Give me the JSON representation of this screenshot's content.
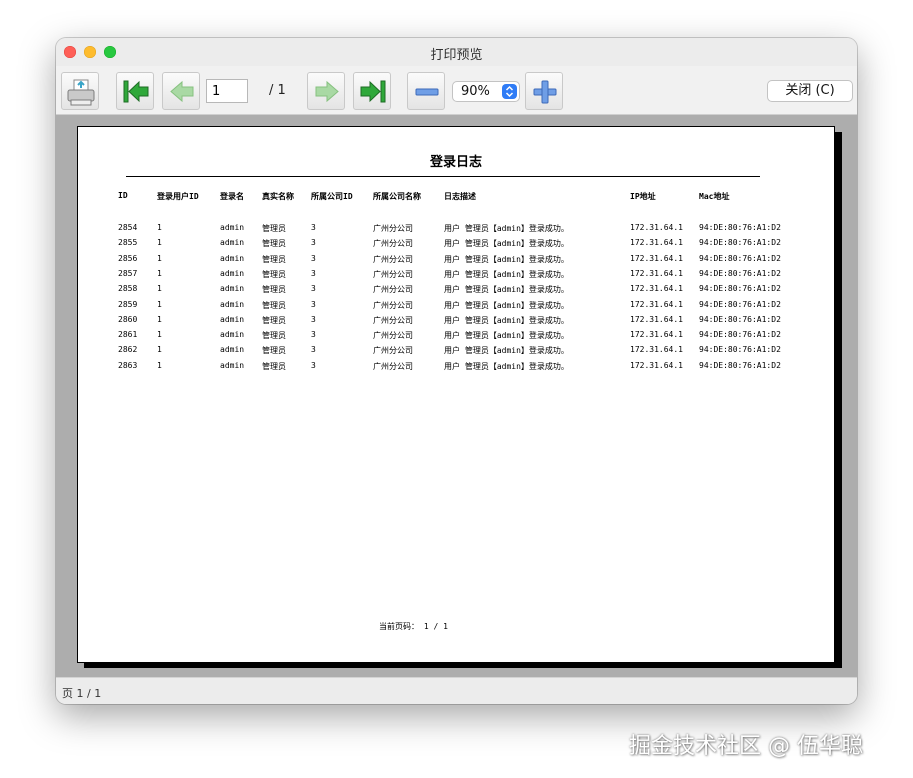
{
  "window": {
    "title": "打印预览"
  },
  "toolbar": {
    "page_value": "1",
    "page_total": "/ 1",
    "zoom_value": "90%",
    "close_label": "关闭 (C)",
    "icons": {
      "print": "printer-icon",
      "first": "first-page-icon",
      "prev": "previous-page-icon",
      "next": "next-page-icon",
      "last": "last-page-icon",
      "zoom_out": "zoom-out-icon",
      "zoom_in": "zoom-in-icon"
    }
  },
  "report": {
    "title": "登录日志",
    "columns": [
      "ID",
      "登录用户ID",
      "登录名",
      "真实名称",
      "所属公司ID",
      "所属公司名称",
      "日志描述",
      "IP地址",
      "Mac地址"
    ],
    "rows": [
      [
        "2854",
        "1",
        "admin",
        "管理员",
        "3",
        "广州分公司",
        "用户 管理员【admin】登录成功。",
        "172.31.64.1",
        "94:DE:80:76:A1:D2"
      ],
      [
        "2855",
        "1",
        "admin",
        "管理员",
        "3",
        "广州分公司",
        "用户 管理员【admin】登录成功。",
        "172.31.64.1",
        "94:DE:80:76:A1:D2"
      ],
      [
        "2856",
        "1",
        "admin",
        "管理员",
        "3",
        "广州分公司",
        "用户 管理员【admin】登录成功。",
        "172.31.64.1",
        "94:DE:80:76:A1:D2"
      ],
      [
        "2857",
        "1",
        "admin",
        "管理员",
        "3",
        "广州分公司",
        "用户 管理员【admin】登录成功。",
        "172.31.64.1",
        "94:DE:80:76:A1:D2"
      ],
      [
        "2858",
        "1",
        "admin",
        "管理员",
        "3",
        "广州分公司",
        "用户 管理员【admin】登录成功。",
        "172.31.64.1",
        "94:DE:80:76:A1:D2"
      ],
      [
        "2859",
        "1",
        "admin",
        "管理员",
        "3",
        "广州分公司",
        "用户 管理员【admin】登录成功。",
        "172.31.64.1",
        "94:DE:80:76:A1:D2"
      ],
      [
        "2860",
        "1",
        "admin",
        "管理员",
        "3",
        "广州分公司",
        "用户 管理员【admin】登录成功。",
        "172.31.64.1",
        "94:DE:80:76:A1:D2"
      ],
      [
        "2861",
        "1",
        "admin",
        "管理员",
        "3",
        "广州分公司",
        "用户 管理员【admin】登录成功。",
        "172.31.64.1",
        "94:DE:80:76:A1:D2"
      ],
      [
        "2862",
        "1",
        "admin",
        "管理员",
        "3",
        "广州分公司",
        "用户 管理员【admin】登录成功。",
        "172.31.64.1",
        "94:DE:80:76:A1:D2"
      ],
      [
        "2863",
        "1",
        "admin",
        "管理员",
        "3",
        "广州分公司",
        "用户 管理员【admin】登录成功。",
        "172.31.64.1",
        "94:DE:80:76:A1:D2"
      ]
    ],
    "footer": "当前页码： 1 / 1"
  },
  "status": {
    "text": "页 1 / 1"
  },
  "watermark": {
    "text": "掘金技术社区 @ 伍华聪"
  },
  "colors": {
    "nav_green": "#2fa83a",
    "nav_green_disabled": "#a9d9a4",
    "zoom_blue": "#4a7fd4",
    "zoom_arrow_blue": "#2f7cf6",
    "preview_background": "#adadad"
  }
}
